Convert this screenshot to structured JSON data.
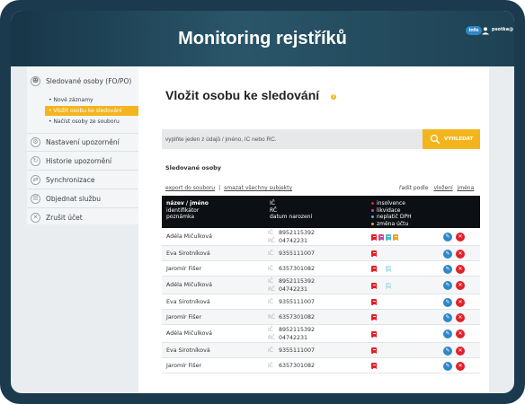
{
  "app": {
    "title": "Monitoring rejstříků",
    "info_label": "info",
    "user_name": "psotka@"
  },
  "colors": {
    "accent": "#f3b51e",
    "header_dark": "#173648",
    "insolvence": "#e2202a",
    "likvidace": "#c24d9a",
    "neplatic_dph": "#4fb8d6",
    "zmena_uctu": "#f3a11e",
    "edit": "#2f86c8",
    "delete": "#e2202a"
  },
  "sidebar": {
    "items": [
      {
        "label": "Sledované osoby (FO/PO)",
        "icon": "person-icon"
      },
      {
        "label": "Nastavení upozornění",
        "icon": "gear-icon"
      },
      {
        "label": "Historie upozornění",
        "icon": "history-icon"
      },
      {
        "label": "Synchronizace",
        "icon": "sync-icon"
      },
      {
        "label": "Objednat službu",
        "icon": "order-icon"
      },
      {
        "label": "Zrušit účet",
        "icon": "cancel-icon"
      }
    ],
    "subitems": [
      {
        "label": "Nové záznamy"
      },
      {
        "label": "Vložit osobu ke sledování",
        "active": true
      },
      {
        "label": "Načíst osoby ze souboru"
      }
    ]
  },
  "main": {
    "title": "Vložit osobu ke sledování",
    "search": {
      "placeholder": "vyplňte jeden z údajů / jméno, IČ nebo RČ.",
      "button_label": "VYHLEDAT"
    },
    "section_title": "Sledované osoby",
    "export_label": "export do souboru",
    "delete_all_label": "smazat všechny subjekty",
    "sort": {
      "label": "řadit podle",
      "by_insert": "vložení",
      "by_name": "jména"
    },
    "table_header": {
      "name": "název / jméno",
      "identifier": "identifikátor",
      "note": "poznámka",
      "ic": "IČ",
      "rc": "RČ",
      "dob": "datum narození"
    },
    "legend": [
      {
        "label": "insolvence",
        "color": "#e2202a"
      },
      {
        "label": "likvidace",
        "color": "#c24d9a"
      },
      {
        "label": "neplatič DPH",
        "color": "#4fb8d6"
      },
      {
        "label": "změna účtu",
        "color": "#f3a11e"
      }
    ],
    "rows": [
      {
        "name": "Adéla Mičulková",
        "keys": [
          "IČ",
          "RČ"
        ],
        "vals": [
          "8952115392",
          "04742231"
        ],
        "docs": [
          "insolvence",
          "likvidace",
          "neplatic_dph",
          "zmena_uctu"
        ]
      },
      {
        "name": "Eva Sirotníková",
        "keys": [
          "IČ"
        ],
        "vals": [
          "9355111007"
        ],
        "docs": [
          "insolvence"
        ]
      },
      {
        "name": "Jaromír Fišer",
        "keys": [
          "IČ"
        ],
        "vals": [
          "6357301082"
        ],
        "docs": [
          "insolvence",
          "",
          "neplatic_dph_light"
        ]
      },
      {
        "name": "Adéla Mičulková",
        "keys": [
          "IČ",
          "RČ"
        ],
        "vals": [
          "8952115392",
          "04742231"
        ],
        "docs": [
          "insolvence",
          "",
          "neplatic_dph_light"
        ]
      },
      {
        "name": "Eva Sirotníková",
        "keys": [
          "IČ"
        ],
        "vals": [
          "9355111007"
        ],
        "docs": [
          "insolvence"
        ]
      },
      {
        "name": "Jaromír Fišer",
        "keys": [
          "RČ"
        ],
        "vals": [
          "6357301082"
        ],
        "docs": [
          "insolvence"
        ]
      },
      {
        "name": "Adéla Mičulková",
        "keys": [
          "IČ",
          "RČ"
        ],
        "vals": [
          "8952115392",
          "04742231"
        ],
        "docs": [
          "insolvence"
        ]
      },
      {
        "name": "Eva Sirotníková",
        "keys": [
          "IČ"
        ],
        "vals": [
          "9355111007"
        ],
        "docs": [
          "insolvence"
        ]
      },
      {
        "name": "Jaromír Fišer",
        "keys": [
          "IČ"
        ],
        "vals": [
          "6357301082"
        ],
        "docs": [
          "insolvence"
        ]
      }
    ]
  }
}
